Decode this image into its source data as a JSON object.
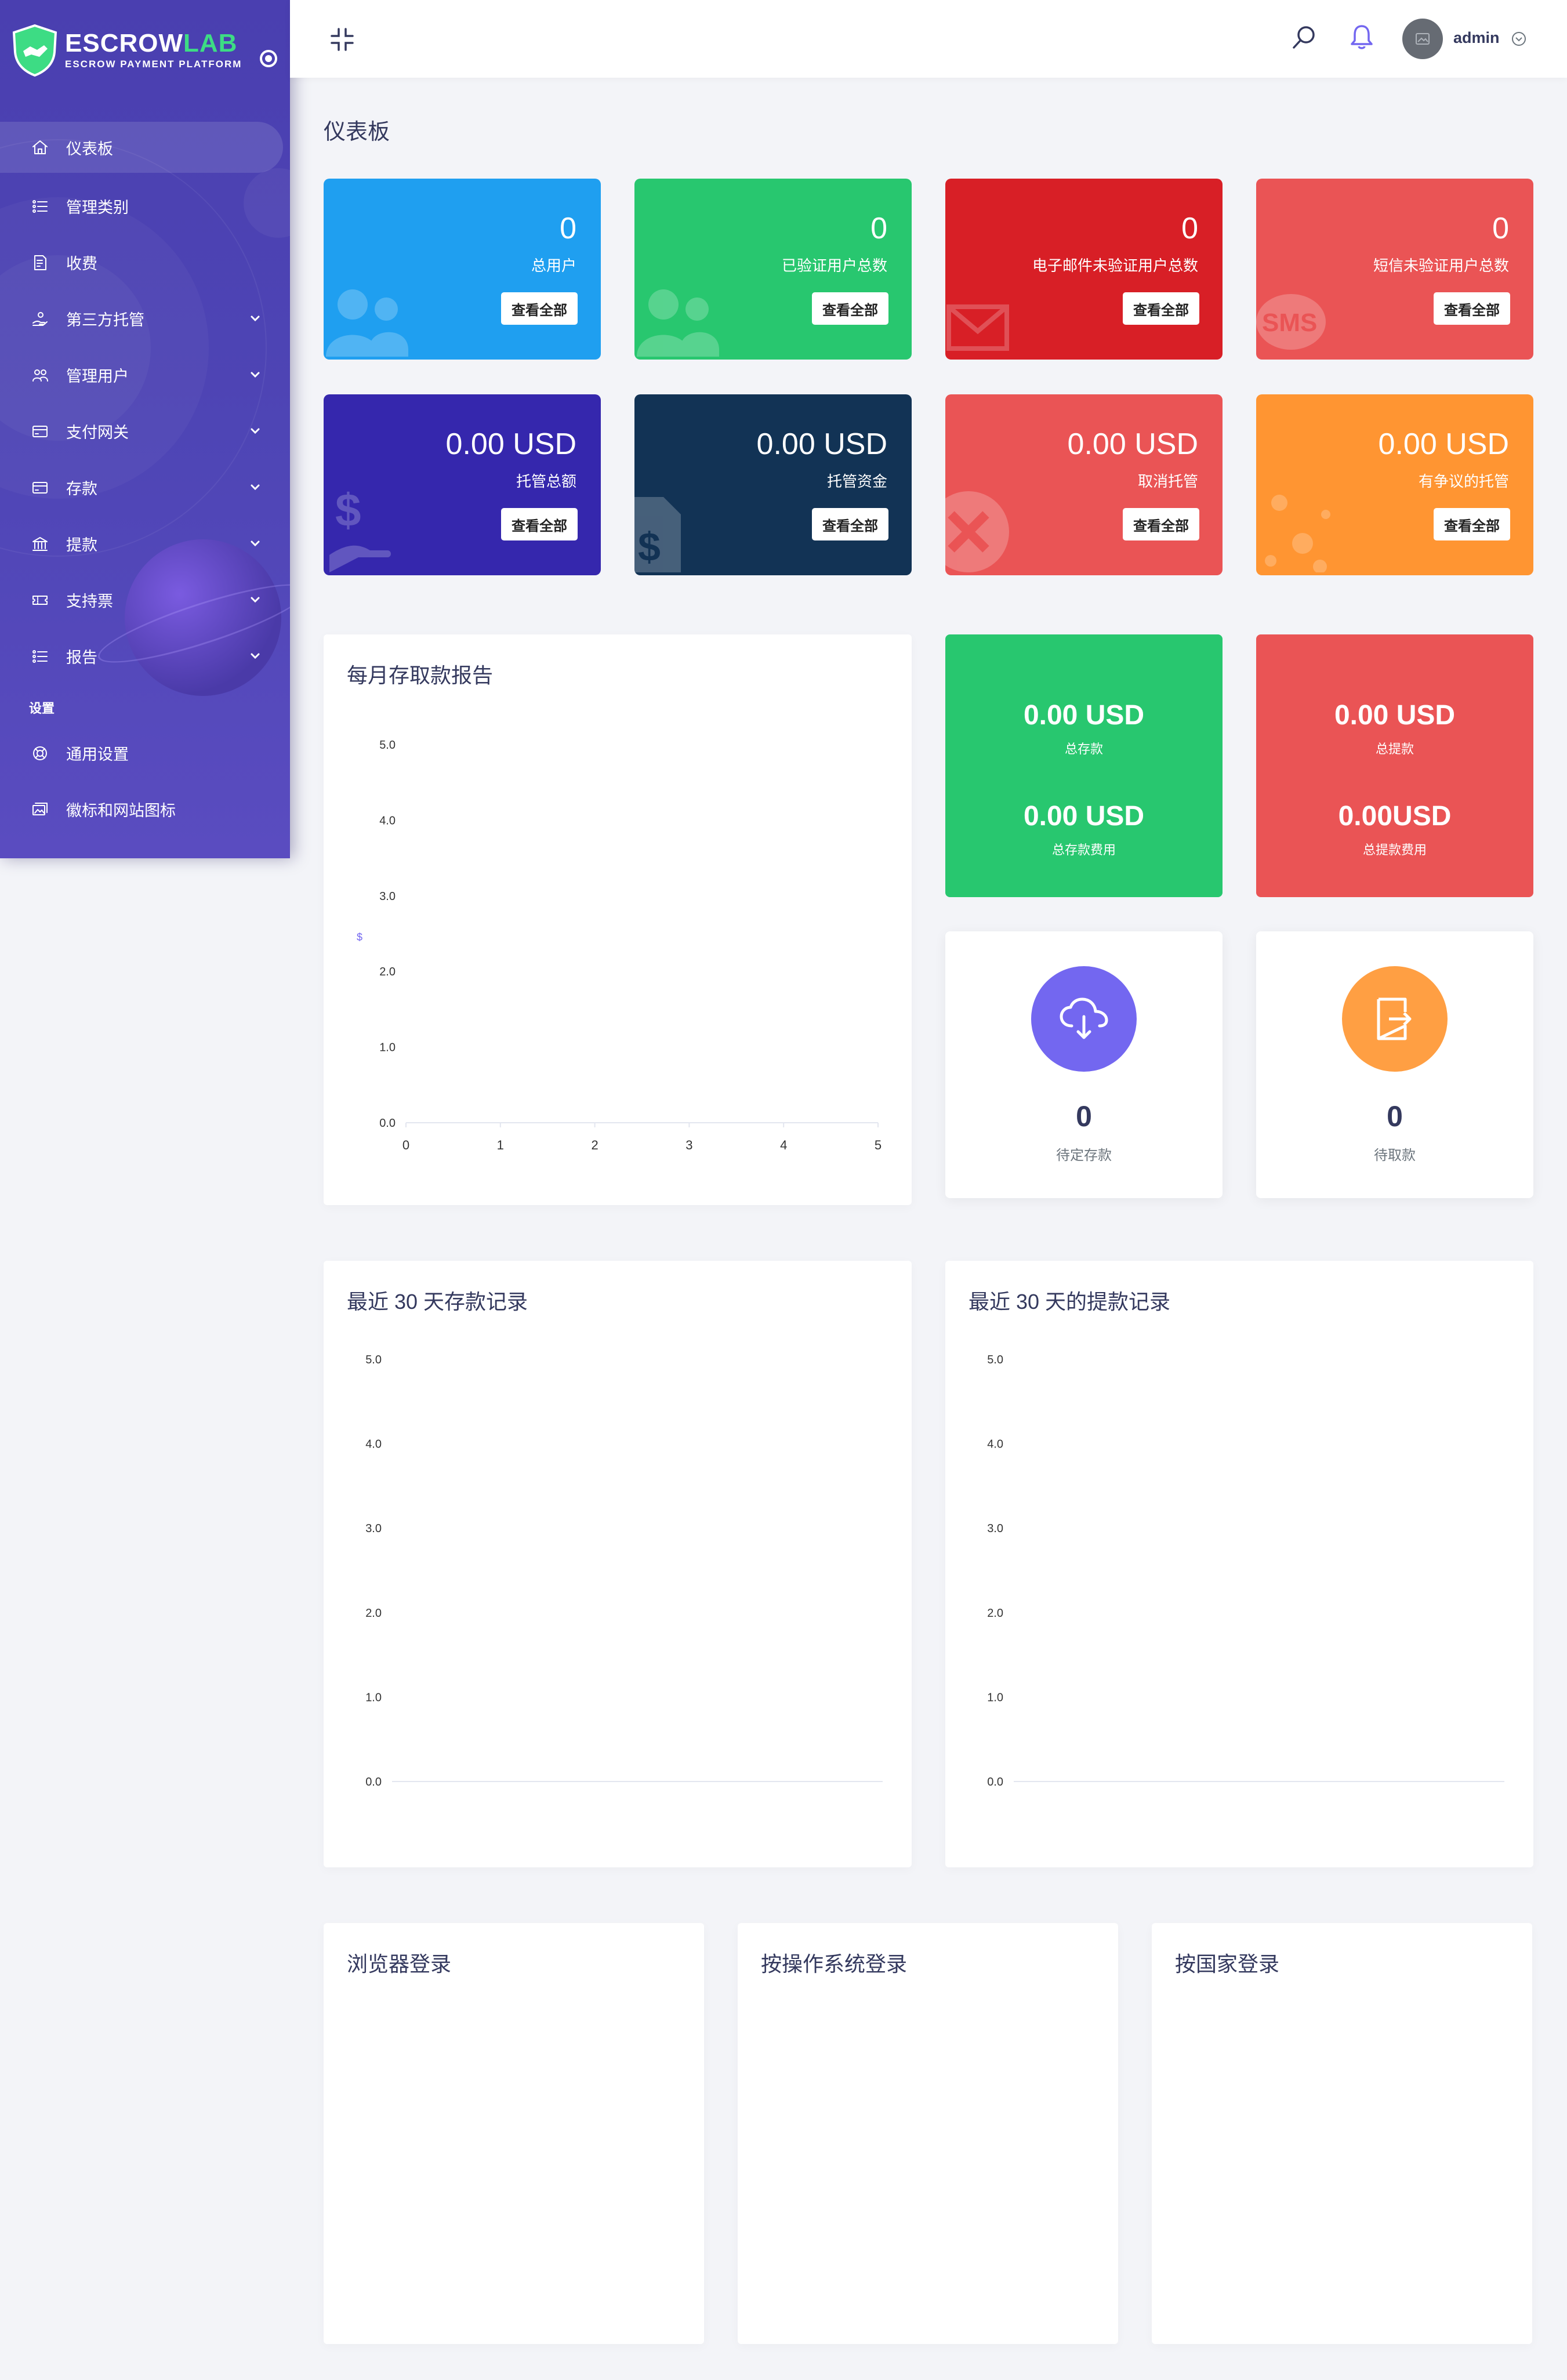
{
  "brand": {
    "name_main": "ESCROW",
    "name_accent": "LAB",
    "tagline": "ESCROW PAYMENT PLATFORM"
  },
  "sidebar": {
    "items": [
      {
        "label": "仪表板",
        "icon": "home-icon",
        "active": true,
        "has_submenu": false
      },
      {
        "label": "管理类别",
        "icon": "list-icon",
        "active": false,
        "has_submenu": false
      },
      {
        "label": "收费",
        "icon": "receipt-icon",
        "active": false,
        "has_submenu": false
      },
      {
        "label": "第三方托管",
        "icon": "hand-coin-icon",
        "active": false,
        "has_submenu": true
      },
      {
        "label": "管理用户",
        "icon": "users-icon",
        "active": false,
        "has_submenu": true
      },
      {
        "label": "支付网关",
        "icon": "credit-card-icon",
        "active": false,
        "has_submenu": true
      },
      {
        "label": "存款",
        "icon": "credit-card-icon",
        "active": false,
        "has_submenu": true
      },
      {
        "label": "提款",
        "icon": "bank-icon",
        "active": false,
        "has_submenu": true
      },
      {
        "label": "支持票",
        "icon": "ticket-icon",
        "active": false,
        "has_submenu": true
      },
      {
        "label": "报告",
        "icon": "list-icon",
        "active": false,
        "has_submenu": true
      }
    ],
    "section_label": "设置",
    "settings_items": [
      {
        "label": "通用设置",
        "icon": "life-ring-icon"
      },
      {
        "label": "徽标和网站图标",
        "icon": "images-icon"
      }
    ]
  },
  "header": {
    "username": "admin"
  },
  "page_title": "仪表板",
  "widgets_row1": [
    {
      "value": "0",
      "label": "总用户",
      "button": "查看全部",
      "color": "#1f9ff0",
      "icon": "users-icon"
    },
    {
      "value": "0",
      "label": "已验证用户总数",
      "button": "查看全部",
      "color": "#28c76f",
      "icon": "users-icon"
    },
    {
      "value": "0",
      "label": "电子邮件未验证用户总数",
      "button": "查看全部",
      "color": "#d81f26",
      "icon": "envelope-icon"
    },
    {
      "value": "0",
      "label": "短信未验证用户总数",
      "button": "查看全部",
      "color": "#ea5455",
      "icon": "sms-icon"
    }
  ],
  "widgets_row2": [
    {
      "value": "0.00 USD",
      "label": "托管总额",
      "button": "查看全部",
      "color": "#3527ad",
      "icon": "hand-dollar-icon"
    },
    {
      "value": "0.00 USD",
      "label": "托管资金",
      "button": "查看全部",
      "color": "#123355",
      "icon": "file-dollar-icon"
    },
    {
      "value": "0.00 USD",
      "label": "取消托管",
      "button": "查看全部",
      "color": "#ea5455",
      "icon": "times-circle-icon"
    },
    {
      "value": "0.00 USD",
      "label": "有争议的托管",
      "button": "查看全部",
      "color": "#ff9532",
      "icon": "dots-icon"
    }
  ],
  "monthly_report": {
    "title": "每月存取款报告",
    "y_axis_symbol": "$"
  },
  "deposit_summary": {
    "value1": "0.00 USD",
    "label1": "总存款",
    "value2": "0.00 USD",
    "label2": "总存款费用",
    "color": "#28c76f"
  },
  "withdraw_summary": {
    "value1": "0.00 USD",
    "label1": "总提款",
    "value2": "0.00USD",
    "label2": "总提款费用",
    "color": "#ea5455"
  },
  "pending": [
    {
      "value": "0",
      "label": "待定存款",
      "color": "#7367f0",
      "icon": "cloud-download-icon"
    },
    {
      "value": "0",
      "label": "待取款",
      "color": "#ff9f43",
      "icon": "sign-out-icon"
    }
  ],
  "deposit_history": {
    "title": "最近 30 天存款记录"
  },
  "withdraw_history": {
    "title": "最近 30 天的提款记录"
  },
  "login_panels": [
    {
      "title": "浏览器登录"
    },
    {
      "title": "按操作系统登录"
    },
    {
      "title": "按国家登录"
    }
  ],
  "chart_data": [
    {
      "type": "line",
      "title": "每月存取款报告",
      "x": [
        0,
        1,
        2,
        3,
        4,
        5
      ],
      "y_ticks": [
        0.0,
        1.0,
        2.0,
        3.0,
        4.0,
        5.0
      ],
      "xlim": [
        0,
        5
      ],
      "ylim": [
        0,
        5
      ],
      "ylabel": "$",
      "series": []
    },
    {
      "type": "line",
      "title": "最近 30 天存款记录",
      "y_ticks": [
        0.0,
        1.0,
        2.0,
        3.0,
        4.0,
        5.0
      ],
      "ylim": [
        0,
        5
      ],
      "series": []
    },
    {
      "type": "line",
      "title": "最近 30 天的提款记录",
      "y_ticks": [
        0.0,
        1.0,
        2.0,
        3.0,
        4.0,
        5.0
      ],
      "ylim": [
        0,
        5
      ],
      "series": []
    }
  ]
}
